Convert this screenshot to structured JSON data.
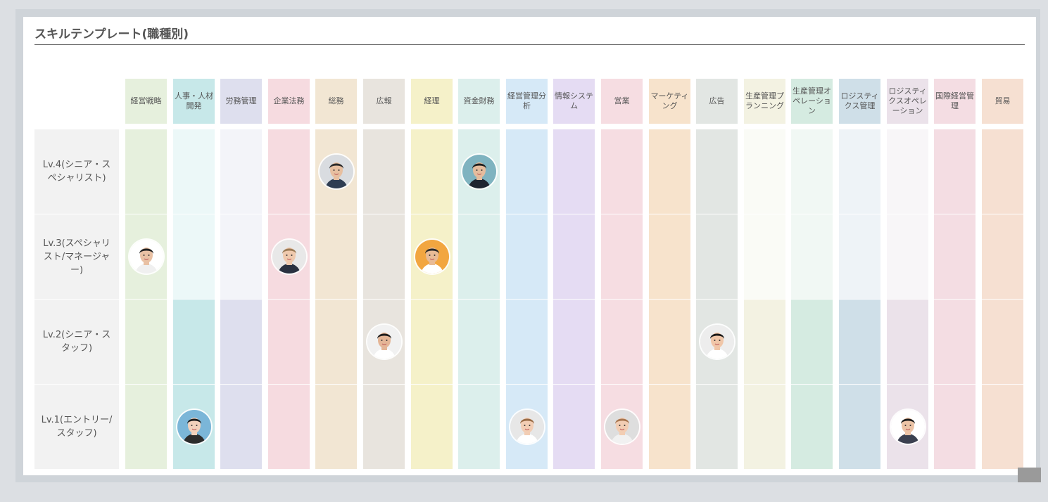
{
  "title": "スキルテンプレート(職種別)",
  "columns": [
    {
      "label": "経営戦略",
      "head": "#e6f0dd",
      "body": "#e6f0dd",
      "pale": "#e6f0dd"
    },
    {
      "label": "人事・人材開発",
      "head": "#c7e8e9",
      "body": "#c7e8e9",
      "pale": "#ecf8f8"
    },
    {
      "label": "労務管理",
      "head": "#dedfee",
      "body": "#dedfee",
      "pale": "#f3f4f9"
    },
    {
      "label": "企業法務",
      "head": "#f6dbe0",
      "body": "#f6dbe0",
      "pale": "#f6dbe0"
    },
    {
      "label": "総務",
      "head": "#f2e6d3",
      "body": "#f2e6d3",
      "pale": "#f2e6d3"
    },
    {
      "label": "広報",
      "head": "#e8e4de",
      "body": "#e8e4de",
      "pale": "#e8e4de"
    },
    {
      "label": "経理",
      "head": "#f5f1c9",
      "body": "#f5f1c9",
      "pale": "#f5f1c9"
    },
    {
      "label": "資金財務",
      "head": "#dcefec",
      "body": "#dcefec",
      "pale": "#dcefec"
    },
    {
      "label": "経営管理分析",
      "head": "#d6e9f7",
      "body": "#d6e9f7",
      "pale": "#d6e9f7"
    },
    {
      "label": "情報システム",
      "head": "#e5dcf3",
      "body": "#e5dcf3",
      "pale": "#e5dcf3"
    },
    {
      "label": "営業",
      "head": "#f6dde2",
      "body": "#f6dde2",
      "pale": "#f6dde2"
    },
    {
      "label": "マーケティング",
      "head": "#f7e3cc",
      "body": "#f7e3cc",
      "pale": "#f7e3cc"
    },
    {
      "label": "広告",
      "head": "#e2e6e3",
      "body": "#e2e6e3",
      "pale": "#e2e6e3"
    },
    {
      "label": "生産管理プランニング",
      "head": "#f3f2e2",
      "body": "#f3f2e2",
      "pale": "#fafbf6"
    },
    {
      "label": "生産管理オペレーション",
      "head": "#d5ebe1",
      "body": "#d5ebe1",
      "pale": "#f1f8f4"
    },
    {
      "label": "ロジスティクス管理",
      "head": "#cfdfe8",
      "body": "#cfdfe8",
      "pale": "#eef3f7"
    },
    {
      "label": "ロジスティクスオペレーション",
      "head": "#ebe2ea",
      "body": "#ebe2ea",
      "pale": "#f8f6f8"
    },
    {
      "label": "国際経営管理",
      "head": "#f4dde3",
      "body": "#f4dde3",
      "pale": "#f4dde3"
    },
    {
      "label": "貿易",
      "head": "#f6e0d2",
      "body": "#f6e0d2",
      "pale": "#f6e0d2"
    }
  ],
  "rows": [
    {
      "label": "Lv.4(シニア・スペシャリスト)"
    },
    {
      "label": "Lv.3(スペシャリスト/マネージャー)"
    },
    {
      "label": "Lv.2(シニア・スタッフ)"
    },
    {
      "label": "Lv.1(エントリー/スタッフ)"
    }
  ],
  "avatars": [
    {
      "row": 0,
      "col": 4,
      "bg": "#d9dce0",
      "skin": "#e7bfa0",
      "hair": "#2b2b2b",
      "shirt": "#2f3d52"
    },
    {
      "row": 0,
      "col": 7,
      "bg": "#7fb3c0",
      "skin": "#e5bc9d",
      "hair": "#1f1f1f",
      "shirt": "#1e2430"
    },
    {
      "row": 1,
      "col": 0,
      "bg": "#ffffff",
      "skin": "#e9c1a4",
      "hair": "#222222",
      "shirt": "#f0f0f0"
    },
    {
      "row": 1,
      "col": 3,
      "bg": "#e8e8e8",
      "skin": "#efc9ad",
      "hair": "#9b7a55",
      "shirt": "#2a3140"
    },
    {
      "row": 1,
      "col": 6,
      "bg": "#f2a640",
      "skin": "#e8bb96",
      "hair": "#2a2a2a",
      "shirt": "#ffffff"
    },
    {
      "row": 2,
      "col": 5,
      "bg": "#f1f1f1",
      "skin": "#e4b596",
      "hair": "#1d1d1d",
      "shirt": "#ffffff"
    },
    {
      "row": 2,
      "col": 12,
      "bg": "#ededed",
      "skin": "#f0c6a8",
      "hair": "#1a1a1a",
      "shirt": "#ffffff"
    },
    {
      "row": 3,
      "col": 1,
      "bg": "#7bb6d8",
      "skin": "#f2d1bb",
      "hair": "#1c1c1c",
      "shirt": "#2c2c2c"
    },
    {
      "row": 3,
      "col": 8,
      "bg": "#e7e7e7",
      "skin": "#f2cdb4",
      "hair": "#9a6c47",
      "shirt": "#ffffff"
    },
    {
      "row": 3,
      "col": 10,
      "bg": "#dedede",
      "skin": "#f2cdb3",
      "hair": "#a87650",
      "shirt": "#f1f1f1"
    },
    {
      "row": 3,
      "col": 16,
      "bg": "#ffffff",
      "skin": "#ecc3a6",
      "hair": "#1e1e1e",
      "shirt": "#3b4050"
    }
  ]
}
